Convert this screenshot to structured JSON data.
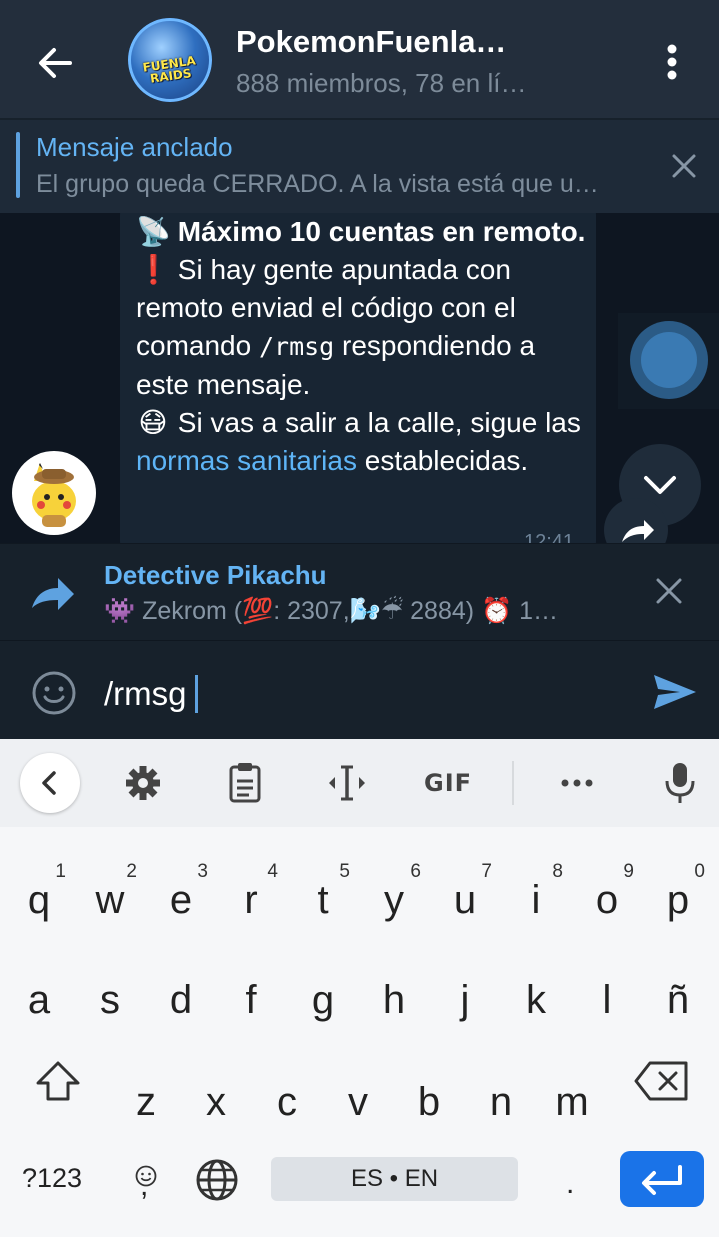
{
  "header": {
    "title": "PokemonFuenla…",
    "subtitle": "888 miembros, 78 en lí…",
    "avatar_text": "FUENLA RAIDS"
  },
  "pinned": {
    "title": "Mensaje anclado",
    "text": "El grupo queda CERRADO.  A la vista está que u…"
  },
  "message": {
    "line1_emoji": "📡",
    "line1_bold": "Máximo 10 cuentas en remoto.",
    "line2_emoji": "❗",
    "line2_a": "Si hay gente apuntada con remoto enviad el código con el comando ",
    "line2_cmd": "/rmsg",
    "line2_b": " respondiendo a este mensaje.",
    "line3_emoji": "😷",
    "line3_a": "Si vas a salir a la calle, sigue las ",
    "line3_link": "normas sanitarias",
    "line3_b": " establecidas.",
    "time": "12:41"
  },
  "reply": {
    "name": "Detective Pikachu",
    "text": "👾 Zekrom (💯: 2307,🌬️☔ 2884) ⏰ 1…"
  },
  "input": {
    "value": "/rmsg"
  },
  "keyboard": {
    "toolbar": {
      "gif": "GIF"
    },
    "row1": [
      {
        "l": "q",
        "n": "1"
      },
      {
        "l": "w",
        "n": "2"
      },
      {
        "l": "e",
        "n": "3"
      },
      {
        "l": "r",
        "n": "4"
      },
      {
        "l": "t",
        "n": "5"
      },
      {
        "l": "y",
        "n": "6"
      },
      {
        "l": "u",
        "n": "7"
      },
      {
        "l": "i",
        "n": "8"
      },
      {
        "l": "o",
        "n": "9"
      },
      {
        "l": "p",
        "n": "0"
      }
    ],
    "row2": [
      "a",
      "s",
      "d",
      "f",
      "g",
      "h",
      "j",
      "k",
      "l",
      "ñ"
    ],
    "row3": [
      "z",
      "x",
      "c",
      "v",
      "b",
      "n",
      "m"
    ],
    "symbols": "?123",
    "comma": ",",
    "space": "ES • EN",
    "period": "."
  },
  "colors": {
    "header_bg": "#232e3c",
    "chat_bg": "#0e1621",
    "accent": "#5eb5f7",
    "enter_key": "#1a73e8"
  }
}
